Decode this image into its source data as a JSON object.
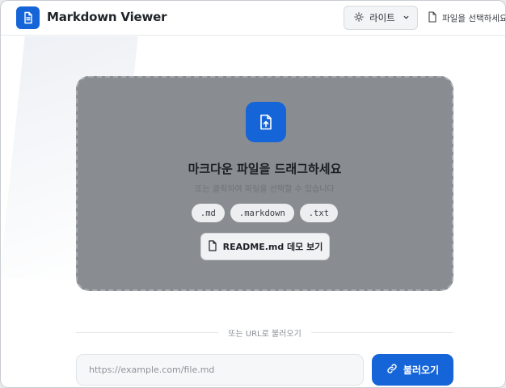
{
  "app": {
    "title": "Markdown Viewer"
  },
  "header": {
    "theme_label": "라이트",
    "file_select_label": "파일을 선택하세요"
  },
  "dropzone": {
    "title": "마크다운 파일을 드래그하세요",
    "subtitle": "또는 클릭하여 파일을 선택할 수 있습니다",
    "extensions": [
      ".md",
      ".markdown",
      ".txt"
    ],
    "demo_button_label": "README.md 데모 보기"
  },
  "url_section": {
    "divider_text": "또는 URL로 불러오기",
    "input_placeholder": "https://example.com/file.md",
    "input_value": "",
    "load_button_label": "불러오기"
  },
  "icons": {
    "logo": "document-icon",
    "theme": "sun-icon",
    "theme_dropdown": "chevron-down-icon",
    "file_select": "file-icon",
    "upload": "file-upload-icon",
    "demo": "file-icon",
    "load": "link-icon"
  },
  "colors": {
    "accent": "#1565d8",
    "dropzone_bg": "#898d91",
    "page_bg": "#ffffff"
  }
}
